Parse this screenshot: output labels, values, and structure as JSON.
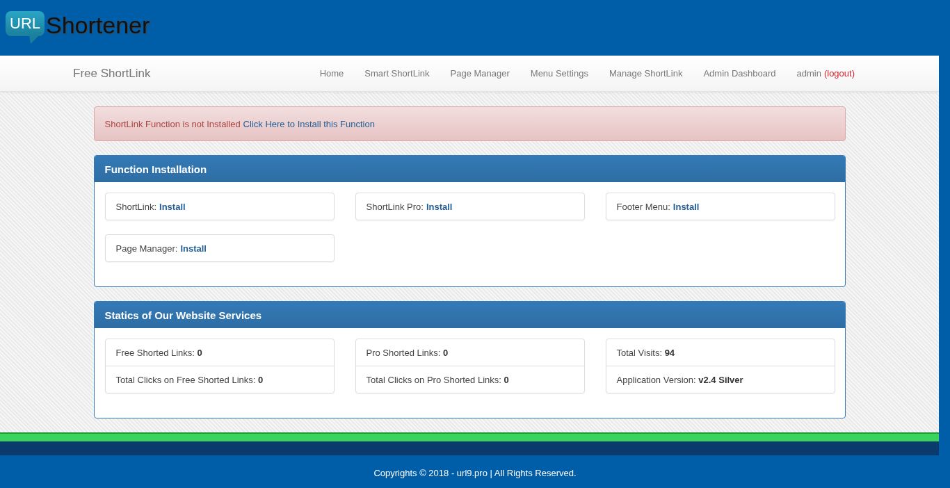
{
  "logo": {
    "badge": "URL",
    "wordmark": "Shortener"
  },
  "navbar": {
    "brand": "Free ShortLink",
    "items": [
      "Home",
      "Smart ShortLink",
      "Page Manager",
      "Menu Settings",
      "Manage ShortLink",
      "Admin Dashboard"
    ],
    "user": "admin",
    "logout": "(logout)"
  },
  "alert": {
    "text": "ShortLink Function is not Installed",
    "link": "Click Here to Install this Function"
  },
  "installation": {
    "title": "Function Installation",
    "items": [
      {
        "label": "ShortLink:",
        "action": "Install"
      },
      {
        "label": "ShortLink Pro:",
        "action": "Install"
      },
      {
        "label": "Footer Menu:",
        "action": "Install"
      },
      {
        "label": "Page Manager:",
        "action": "Install"
      }
    ]
  },
  "statistics": {
    "title": "Statics of Our Website Services",
    "groups": [
      [
        "Free Shorted Links: **0**",
        "Total Clicks on Free Shorted Links: **0**"
      ],
      [
        "Pro Shorted Links: **0**",
        "Total Clicks on Pro Shorted Links: **0**"
      ],
      [
        "Total Visits: **94**",
        "Application Version: **v2.4 Silver**"
      ]
    ]
  },
  "footer": {
    "text": "Copyrights © 2018 - url9.pro | All Rights Reserved."
  }
}
